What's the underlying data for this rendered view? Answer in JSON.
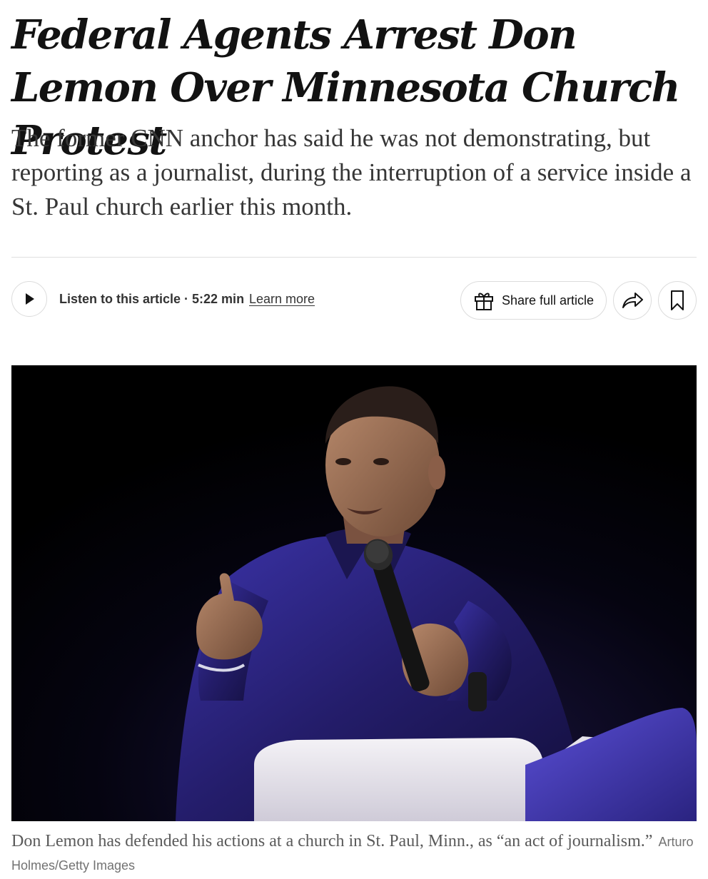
{
  "article": {
    "headline": "Federal Agents Arrest Don Lemon Over Minnesota Church Protest",
    "summary": "The former CNN anchor has said he was not demonstrating, but reporting as a journalist, during the interruption of a service inside a St. Paul church earlier this month."
  },
  "toolbar": {
    "listen_label": "Listen to this article · 5:22 min",
    "learn_more": "Learn more",
    "share_label": "Share full article"
  },
  "media": {
    "caption": "Don Lemon has defended his actions at a church in St. Paul, Minn., as “an act of journalism.”",
    "credit": "Arturo Holmes/Getty Images"
  },
  "icons": {
    "play": "play-icon",
    "gift": "gift-icon",
    "share": "share-arrow-icon",
    "bookmark": "bookmark-icon"
  },
  "colors": {
    "text": "#121212",
    "summary": "#363636",
    "caption": "#5a5a5a",
    "border": "#dcdcdc",
    "photo_background": "#000000",
    "photo_shirt": "#2a2370"
  }
}
